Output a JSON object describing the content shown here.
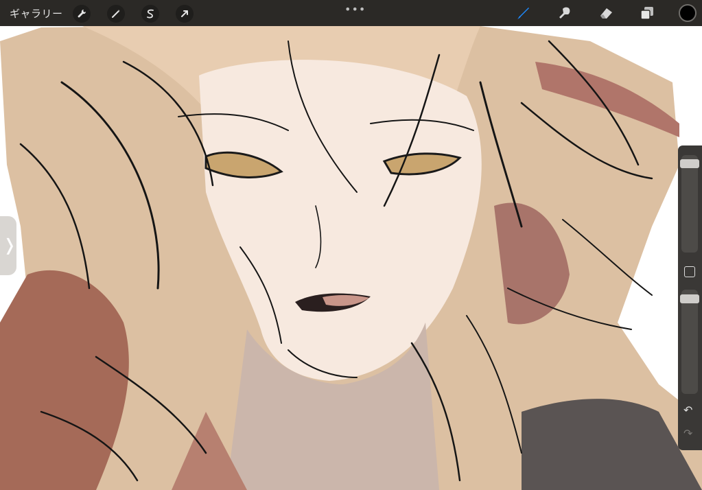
{
  "topbar": {
    "gallery_label": "ギャラリー",
    "dots": "•••",
    "tools_left": [
      {
        "name": "actions",
        "icon": "wrench-icon"
      },
      {
        "name": "adjustments",
        "icon": "magic-wand-icon"
      },
      {
        "name": "selection",
        "icon": "selection-s-icon"
      },
      {
        "name": "transform",
        "icon": "arrow-cursor-icon"
      }
    ],
    "tools_right": [
      {
        "name": "brush",
        "icon": "brush-icon",
        "active": true
      },
      {
        "name": "smudge",
        "icon": "smudge-icon"
      },
      {
        "name": "eraser",
        "icon": "eraser-icon"
      },
      {
        "name": "layers",
        "icon": "layers-icon"
      }
    ],
    "current_color": "#000000",
    "accent": "#1e8bff"
  },
  "sidebar": {
    "brush_size_level": 0.95,
    "opacity_level": 0.95,
    "undo_icon": "undo-icon",
    "redo_icon": "redo-icon"
  },
  "left_handle": {
    "icon": "chevron-right-icon",
    "glyph": "❭"
  },
  "canvas": {
    "subject": "painted-illustration"
  }
}
